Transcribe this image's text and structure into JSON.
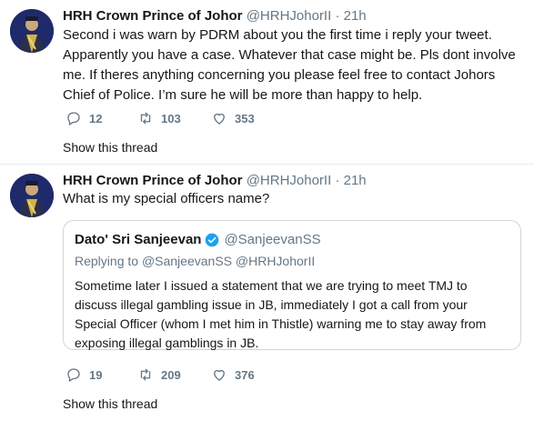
{
  "tweets": [
    {
      "name": "HRH Crown Prince of Johor",
      "handle": "@HRHJohorII",
      "dot": "·",
      "time": "21h",
      "text": "Second i was warn by PDRM about you the first time i reply your tweet. Apparently you have a case. Whatever that case might be. Pls dont involve me. If theres anything concerning you please feel free to contact Johors Chief of Police. I’m sure he will be more than happy to help.",
      "replies": "12",
      "retweets": "103",
      "likes": "353",
      "show_thread": "Show this thread"
    },
    {
      "name": "HRH Crown Prince of Johor",
      "handle": "@HRHJohorII",
      "dot": "·",
      "time": "21h",
      "text": "What is my special officers name?",
      "quote": {
        "name": "Dato' Sri Sanjeevan",
        "handle": "@SanjeevanSS",
        "replying_label": "Replying to",
        "replying_to": "@SanjeevanSS @HRHJohorII",
        "text": "Sometime later I issued a statement that we are trying to meet TMJ to discuss illegal gambling issue in JB, immediately I got a call from your Special Officer (whom I met him in Thistle) warning me to stay away from exposing illegal gamblings in JB."
      },
      "replies": "19",
      "retweets": "209",
      "likes": "376",
      "show_thread": "Show this thread"
    }
  ],
  "colors": {
    "text": "#14171a",
    "secondary": "#657786",
    "border": "#ccd6dd",
    "verified": "#1da1f2",
    "avatar_bg": "#1f2a6b"
  },
  "icons": [
    "reply-icon",
    "retweet-icon",
    "like-icon",
    "verified-badge-icon"
  ]
}
